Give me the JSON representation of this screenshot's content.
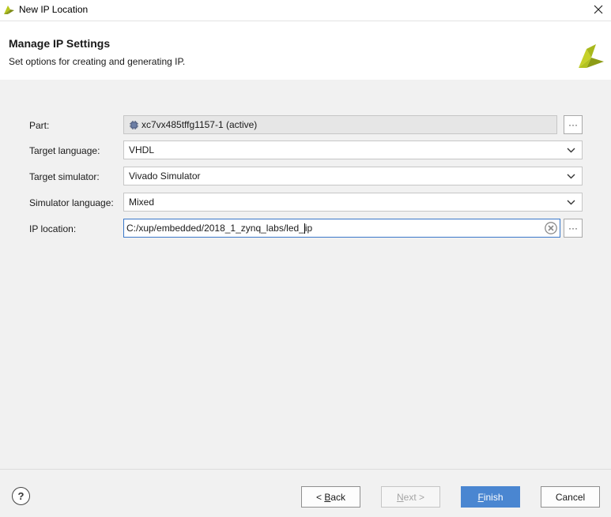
{
  "window": {
    "title": "New IP Location",
    "close_label": "✕"
  },
  "header": {
    "title": "Manage IP Settings",
    "subtitle": "Set options for creating and generating IP."
  },
  "form": {
    "part": {
      "label": "Part:",
      "value": "xc7vx485tffg1157-1 (active)",
      "browse": "···"
    },
    "target_language": {
      "label": "Target language:",
      "value": "VHDL"
    },
    "target_simulator": {
      "label": "Target simulator:",
      "value": "Vivado Simulator"
    },
    "simulator_language": {
      "label": "Simulator language:",
      "value": "Mixed"
    },
    "ip_location": {
      "label": "IP location:",
      "value_before_cursor": "C:/xup/embedded/2018_1_zynq_labs/led_",
      "value_after_cursor": "ip",
      "browse": "···"
    }
  },
  "footer": {
    "help": "?",
    "back_prefix": "< ",
    "back_mnemonic": "B",
    "back_rest": "ack",
    "next_mnemonic": "N",
    "next_rest": "ext >",
    "finish_mnemonic": "F",
    "finish_rest": "inish",
    "cancel": "Cancel"
  },
  "colors": {
    "accent": "#4a86d1",
    "logo": "#b9c71e"
  }
}
